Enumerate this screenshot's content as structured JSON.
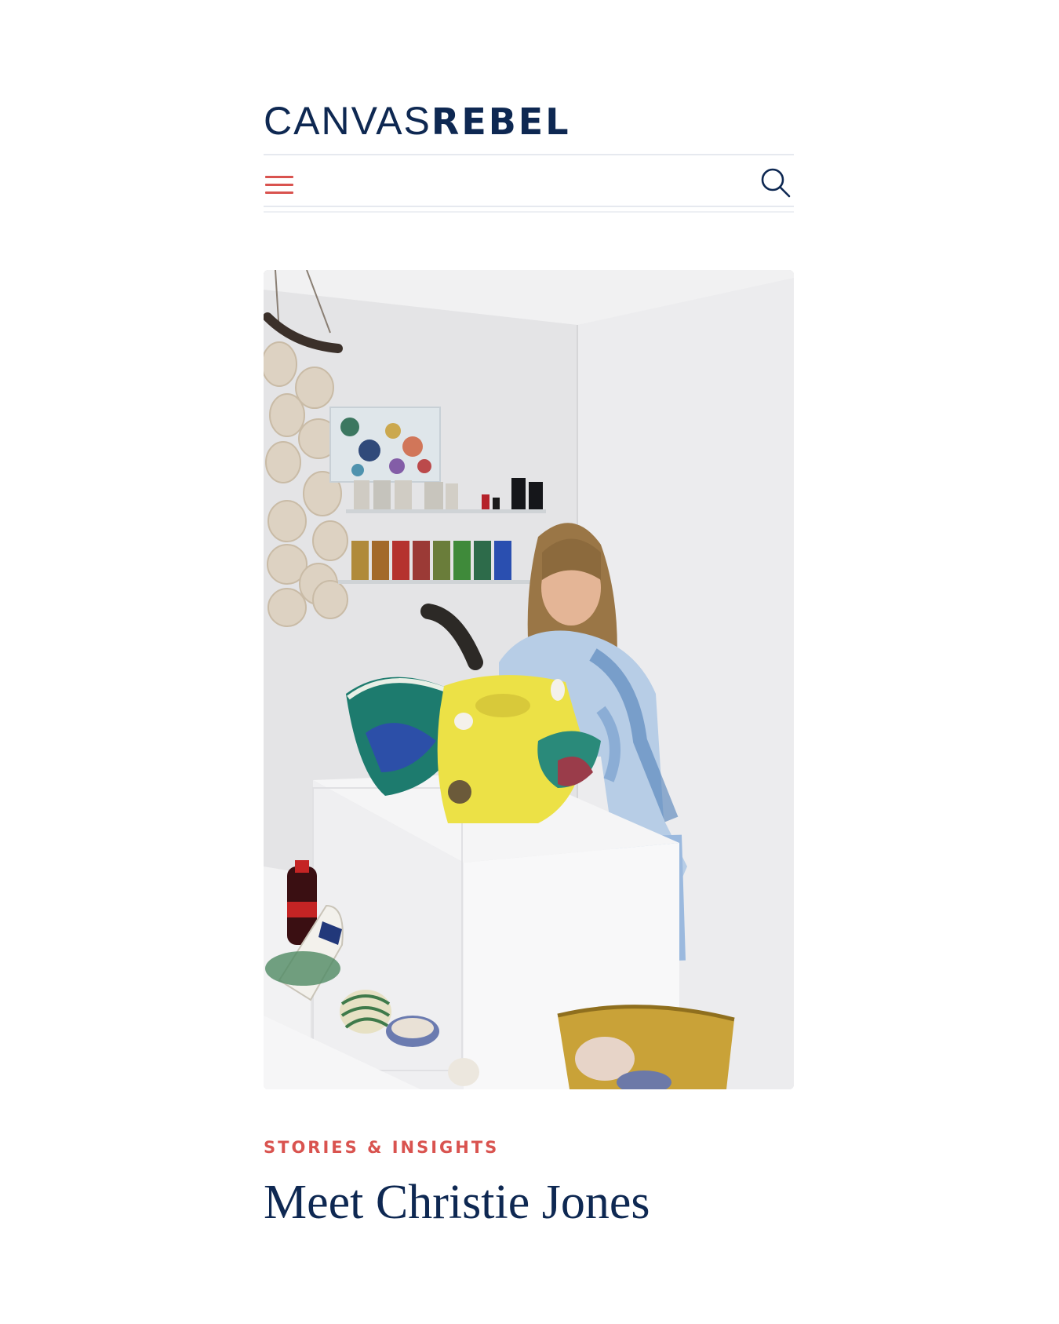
{
  "brand": {
    "name_light": "CANVAS",
    "name_bold": "REBEL",
    "color": "#0e2852",
    "accent": "#d9534f"
  },
  "nav": {
    "menu_icon": "hamburger-menu-icon",
    "search_icon": "search-icon"
  },
  "article": {
    "image_subject": "artist-studio-photo",
    "category": "STORIES & INSIGHTS",
    "title": "Meet Christie Jones"
  }
}
